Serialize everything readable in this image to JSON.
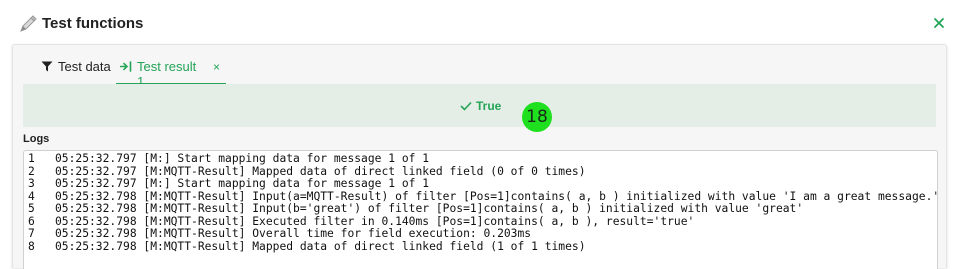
{
  "header": {
    "title": "Test functions",
    "icon": "pen-icon",
    "close_icon": "close-icon"
  },
  "colors": {
    "accent": "#23a457",
    "result_bg": "#e5ede7",
    "badge": "#1ee01e"
  },
  "tabs": [
    {
      "label": "Test data",
      "icon": "filter-icon",
      "active": false
    },
    {
      "label": "Test result 1",
      "icon": "arrow-right-icon",
      "active": true,
      "close": "×"
    }
  ],
  "result": {
    "text": "True",
    "icon": "check-icon"
  },
  "badge": {
    "text": "18"
  },
  "logs": {
    "label": "Logs",
    "lines": [
      {
        "num": "1",
        "text": "05:25:32.797 [M:] Start mapping data for message 1 of 1"
      },
      {
        "num": "2",
        "text": "05:25:32.797 [M:MQTT-Result] Mapped data of direct linked field (0 of 0 times)"
      },
      {
        "num": "3",
        "text": "05:25:32.797 [M:] Start mapping data for message 1 of 1"
      },
      {
        "num": "4",
        "text": "05:25:32.798 [M:MQTT-Result] Input(a=MQTT-Result) of filter [Pos=1]contains( a, b ) initialized with value 'I am a great message.'"
      },
      {
        "num": "5",
        "text": "05:25:32.798 [M:MQTT-Result] Input(b='great') of filter [Pos=1]contains( a, b ) initialized with value 'great'"
      },
      {
        "num": "6",
        "text": "05:25:32.798 [M:MQTT-Result] Executed filter in 0.140ms [Pos=1]contains( a, b ), result='true'"
      },
      {
        "num": "7",
        "text": "05:25:32.798 [M:MQTT-Result] Overall time for field execution: 0.203ms"
      },
      {
        "num": "8",
        "text": "05:25:32.798 [M:MQTT-Result] Mapped data of direct linked field (1 of 1 times)"
      }
    ]
  }
}
